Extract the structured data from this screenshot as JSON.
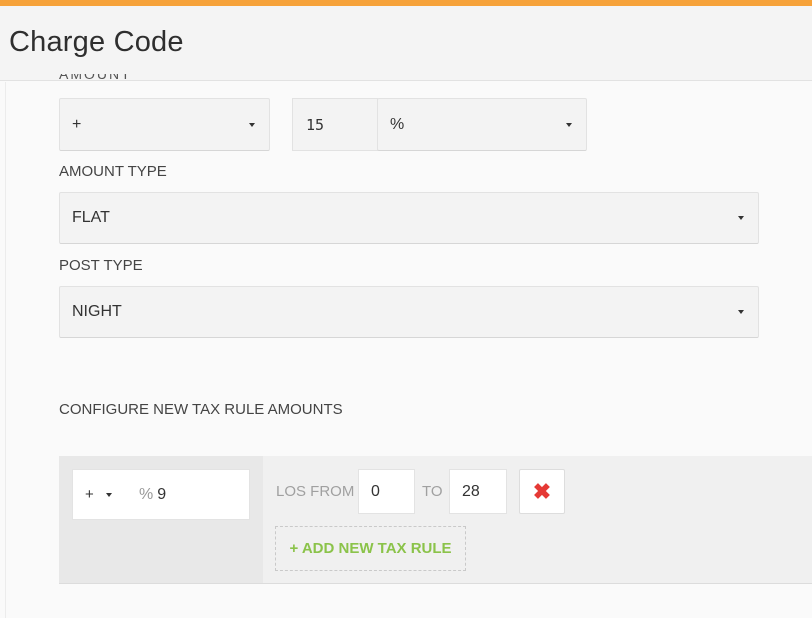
{
  "header": {
    "title": "Charge Code"
  },
  "amount": {
    "label_clipped": "AMOUNT",
    "operator": "+",
    "value": "15",
    "unit": "%"
  },
  "amount_type": {
    "label": "AMOUNT TYPE",
    "value": "FLAT"
  },
  "post_type": {
    "label": "POST TYPE",
    "value": "NIGHT"
  },
  "tax_rules": {
    "heading": "CONFIGURE NEW TAX RULE AMOUNTS",
    "rule": {
      "operator": "+",
      "unit_symbol": "%",
      "amount": "9",
      "los_from_label": "LOS FROM",
      "los_from": "0",
      "to_label": "TO",
      "los_to": "28",
      "delete_icon": "✖"
    },
    "add_button_label": "+ ADD NEW TAX RULE"
  },
  "colors": {
    "accent": "#f6a23a",
    "add": "#8bc34a",
    "delete": "#e53935"
  }
}
